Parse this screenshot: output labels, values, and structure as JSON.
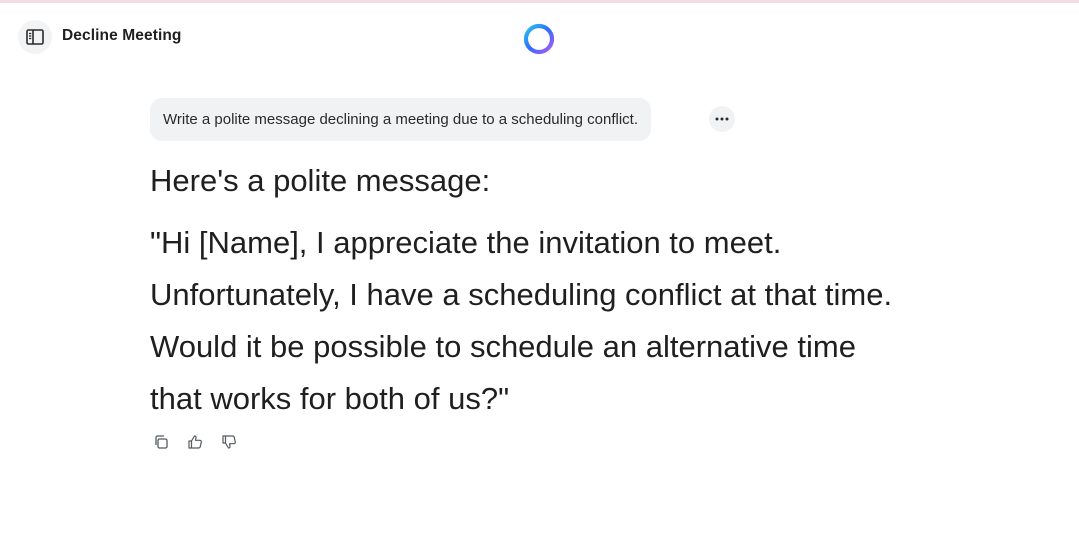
{
  "header": {
    "title": "Decline Meeting",
    "sidebar_toggle_icon": "sidebar-panel-icon",
    "logo_icon": "assistant-ring-logo"
  },
  "conversation": {
    "user_message": "Write a polite message declining a meeting due to a scheduling conflict.",
    "more_icon": "ellipsis-icon",
    "assistant_intro": "Here's a polite message:",
    "assistant_body": "\"Hi [Name], I appreciate the invitation to meet. Unfortunately, I have a scheduling conflict at that time. Would it be possible to schedule an alternative time that works for both of us?\"",
    "actions": {
      "copy_icon": "copy-icon",
      "like_icon": "thumbs-up-icon",
      "dislike_icon": "thumbs-down-icon"
    }
  },
  "colors": {
    "logo_gradient": [
      "#2f6bff",
      "#29c6e8",
      "#b05cf5"
    ],
    "bubble_bg": "#f1f2f4",
    "text": "#1f1f1f",
    "icon": "#555a60"
  }
}
